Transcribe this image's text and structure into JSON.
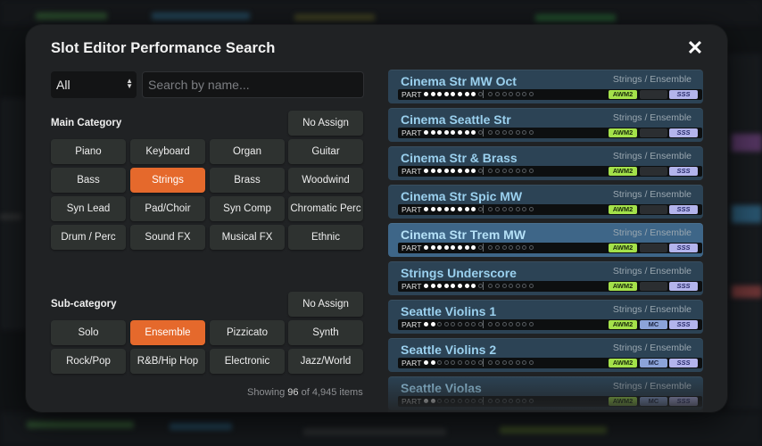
{
  "dialog": {
    "title": "Slot Editor Performance Search",
    "close_symbol": "✕"
  },
  "filter": {
    "selected": "All",
    "search_placeholder": "Search by name..."
  },
  "main_category": {
    "label": "Main Category",
    "no_assign": "No Assign",
    "active": "Strings",
    "items": [
      "Piano",
      "Keyboard",
      "Organ",
      "Guitar",
      "Bass",
      "Strings",
      "Brass",
      "Woodwind",
      "Syn Lead",
      "Pad/Choir",
      "Syn Comp",
      "Chromatic Perc",
      "Drum / Perc",
      "Sound FX",
      "Musical FX",
      "Ethnic"
    ]
  },
  "sub_category": {
    "label": "Sub-category",
    "no_assign": "No Assign",
    "active": "Ensemble",
    "items": [
      "Solo",
      "Ensemble",
      "Pizzicato",
      "Synth",
      "Rock/Pop",
      "R&B/Hip Hop",
      "Electronic",
      "Jazz/World"
    ]
  },
  "status": {
    "prefix": "Showing",
    "shown": "96",
    "middle": "of",
    "total": "4,945",
    "suffix": "items"
  },
  "results": [
    {
      "name": "Cinema Str MW Oct",
      "category": "Strings / Ensemble",
      "part_label": "PART",
      "parts_on": 8,
      "parts_total": 16,
      "awm2": "AWM2",
      "mc": "",
      "sss": "SSS",
      "selected": false
    },
    {
      "name": "Cinema Seattle Str",
      "category": "Strings / Ensemble",
      "part_label": "PART",
      "parts_on": 8,
      "parts_total": 16,
      "awm2": "AWM2",
      "mc": "",
      "sss": "SSS",
      "selected": false
    },
    {
      "name": "Cinema Str & Brass",
      "category": "Strings / Ensemble",
      "part_label": "PART",
      "parts_on": 8,
      "parts_total": 16,
      "awm2": "AWM2",
      "mc": "",
      "sss": "SSS",
      "selected": false
    },
    {
      "name": "Cinema Str Spic MW",
      "category": "Strings / Ensemble",
      "part_label": "PART",
      "parts_on": 8,
      "parts_total": 16,
      "awm2": "AWM2",
      "mc": "",
      "sss": "SSS",
      "selected": false
    },
    {
      "name": "Cinema Str Trem MW",
      "category": "Strings / Ensemble",
      "part_label": "PART",
      "parts_on": 8,
      "parts_total": 16,
      "awm2": "AWM2",
      "mc": "",
      "sss": "SSS",
      "selected": true
    },
    {
      "name": "Strings Underscore",
      "category": "Strings / Ensemble",
      "part_label": "PART",
      "parts_on": 8,
      "parts_total": 16,
      "awm2": "AWM2",
      "mc": "",
      "sss": "SSS",
      "selected": false
    },
    {
      "name": "Seattle Violins 1",
      "category": "Strings / Ensemble",
      "part_label": "PART",
      "parts_on": 2,
      "parts_total": 16,
      "awm2": "AWM2",
      "mc": "MC",
      "sss": "SSS",
      "selected": false
    },
    {
      "name": "Seattle Violins 2",
      "category": "Strings / Ensemble",
      "part_label": "PART",
      "parts_on": 2,
      "parts_total": 16,
      "awm2": "AWM2",
      "mc": "MC",
      "sss": "SSS",
      "selected": false
    },
    {
      "name": "Seattle Violas",
      "category": "Strings / Ensemble",
      "part_label": "PART",
      "parts_on": 2,
      "parts_total": 16,
      "awm2": "AWM2",
      "mc": "MC",
      "sss": "SSS",
      "selected": false
    }
  ],
  "colors": {
    "accent": "#e5692c",
    "row": "#2c4355",
    "row_selected": "#3e6688",
    "awm2": "#a4e14a",
    "mc": "#8ba3d8",
    "sss": "#b3b4ec"
  }
}
